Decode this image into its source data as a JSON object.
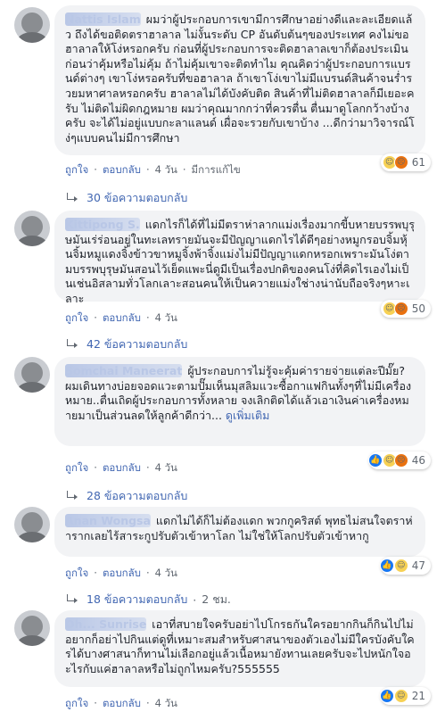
{
  "actions": {
    "like_label": "ถูกใจ",
    "reply_label": "ตอบกลับ",
    "edited_label": "มีการแก้ไข",
    "dot": "·"
  },
  "comments": [
    {
      "author": "Nattis Islam",
      "text": "ผมว่าผู้ประกอบการเขามีการศึกษาอย่างดีและละเอียดแล้ว ถึงได้ขอติดตราฮาลาล ไม่งั้นระดับ CP อันดับต้นๆของประเทศ คงไม่ขอฮาลาลให้โง่หรอกครับ ก่อนที่ผู้ประกอบการจะติดฮาลาลเขาก็ต้องประเมินก่อนว่าคุ้มหรือไม่คุ้ม ถ้าไม่คุ้มเขาจะติดทำไม คุณคิดว่าผู้ประกอบการแบรนด์ต่างๆ เขาโง่หรอครับที่ขอฮาลาล ถ้าเขาโง่เขาไม่มีแบรนด์สินค้าจนร่ำรวยมหาศาลหรอกครับ ฮาลาลไม่ได้บังคับติด สินค้าที่ไม่ติดฮาลาลก็มีเยอะครับ ไม่ติดไม่ผิดกฎหมาย ผมว่าคุณมากกว่าที่ควรตื่น ตื่นมาดูโลกกว้างบ้างครับ จะได้ไม่อยู่แบบกะลาแลนด์ เผื่อจะรวยกับเขาบ้าง ...ดีกว่ามาวิจารณ์โง่ๆแบบคนไม่มีการศึกษา",
      "time": "4 วัน",
      "edited": true,
      "reaction_count": "61",
      "reactions": [
        "haha",
        "angry"
      ],
      "replies": "30 ข้อความตอบกลับ",
      "reply_time": ""
    },
    {
      "author": "Kittipong S.",
      "text": "แดกไรก็ได้ที่ไม่มีตราห่าลากแม่งเรื่องมากขี้บหายบรรพบุรุษมันเร่ร่อนอยู่ในทะเลทรายมันจะมีปัญญาแดกไรได้ดีๆอย่างหมูกรอบจิ้มหุ้นจิ้มหมูแดงจิ้งข้าวขาหมูจิ้งพ้าจิ้งแม่งไม่มีปัญญาแดกหรอกเพราะมันโง่ตามบรรพบุรุษมันสอนไว้เย็ดแพะนี่ดูมีเป็นเรื่องปกติของคนโง่ที่คิดไรเองไม่เป็นเช่นอิสลามทั่วโลกเลาะสอนคนให้เป็นควายแม่งใช่างน่านับถือจริงๆหาะเลาะ",
      "time": "4 วัน",
      "edited": false,
      "reaction_count": "50",
      "reactions": [
        "haha",
        "angry"
      ],
      "replies": "42 ข้อความตอบกลับ",
      "reply_time": ""
    },
    {
      "author": "Somchai Maneerat",
      "text": "ผู้ประกอบการไม่รู้จะคุ้มค่ารายจ่ายแต่ละปีมั๊ย? ผมเดินทางบ่อยจอดแวะตามปั๊มเห็นมุสลิมแวะซื้อกาแฟกินทั้งๆที่ไม่มีเครื่องหมาย..ตื่นเถิดผู้ประกอบการทั้งหลาย จงเลิกติดได้แล้วเอาเงินค่าเครื่องหมายมาเป็นส่วนลดให้ลูกค้าดีกว่า...",
      "see_more": "ดูเพิ่มเติม",
      "time": "4 วัน",
      "edited": false,
      "reaction_count": "46",
      "reactions": [
        "like",
        "haha",
        "angry"
      ],
      "replies": "28 ข้อความตอบกลับ",
      "reply_time": ""
    },
    {
      "author": "Anan Wongsa",
      "text": "แดกไม่ได้ก็ไม่ต้องแดก พวกกูคริสต์ พุทธไม่สนใจตราห่ารากเลยไร้สาระกูปรับตัวเข้าหาโลก ไม่ใช่ให้โลกปรับตัวเข้าหากู",
      "time": "4 วัน",
      "edited": false,
      "reaction_count": "47",
      "reactions": [
        "like",
        "haha"
      ],
      "replies": "18 ข้อความตอบกลับ",
      "reply_time": "2 ชม."
    },
    {
      "author": "Oh... Sunrise",
      "text": "เอาที่สบายใจครับอย่าไปโกรธกันใครอยากกินก็กินไปไม่อยากก็อย่าไปกินแต่ดูที่เหมาะสมสำหรับศาสนาของตัวเองไม่มีใครบังคับใครได้บางศาสนาก็ทานไม่เลือกอยู่แล้วเนื้อหมายังทานเลยครับจะไปหนักใจอะไรกับแค่ฮาลาลหรือไม่ถูกไหมครับ?555555",
      "time": "4 วัน",
      "edited": false,
      "reaction_count": "21",
      "reactions": [
        "like",
        "haha"
      ],
      "replies": "",
      "reply_time": ""
    }
  ]
}
